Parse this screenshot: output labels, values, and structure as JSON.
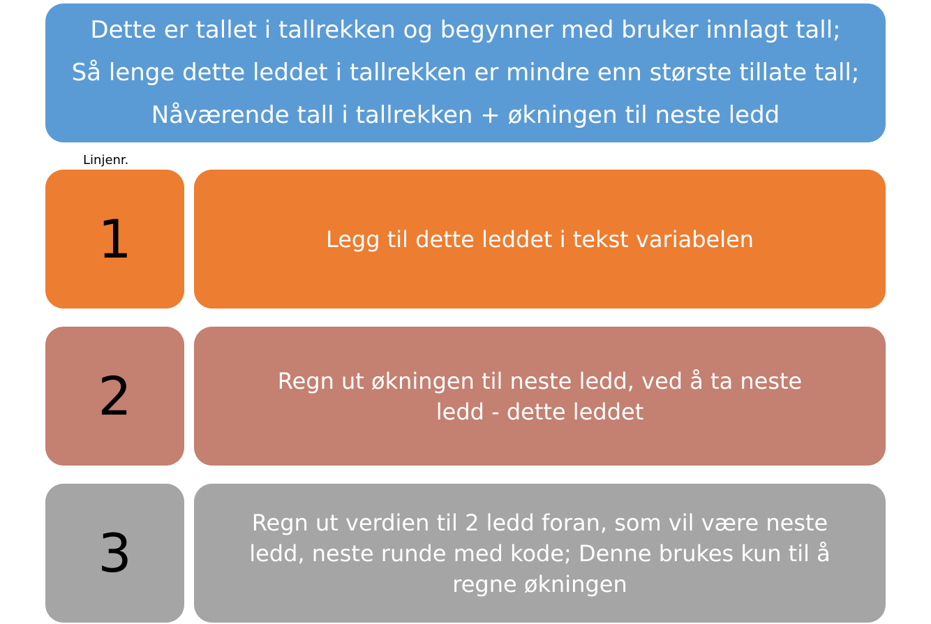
{
  "header": {
    "lines": [
      "Dette er tallet i tallrekken og begynner med bruker innlagt tall;",
      "Så lenge dette leddet i tallrekken er mindre enn største tillate tall;",
      "Nåværende tall i tallrekken + økningen til neste ledd"
    ]
  },
  "line_number_label": "Linjenr.",
  "steps": [
    {
      "number": "1",
      "text": "Legg til dette leddet i tekst variabelen"
    },
    {
      "number": "2",
      "text": "Regn ut økningen til neste ledd, ved å ta neste ledd  - dette leddet"
    },
    {
      "number": "3",
      "text": "Regn ut verdien til 2 ledd foran, som vil være neste ledd, neste runde med kode; Denne brukes kun til å regne økningen"
    }
  ],
  "colors": {
    "header": "#5b9bd5",
    "step1": "#ed7d31",
    "step2": "#c48070",
    "step3": "#a5a5a5"
  }
}
